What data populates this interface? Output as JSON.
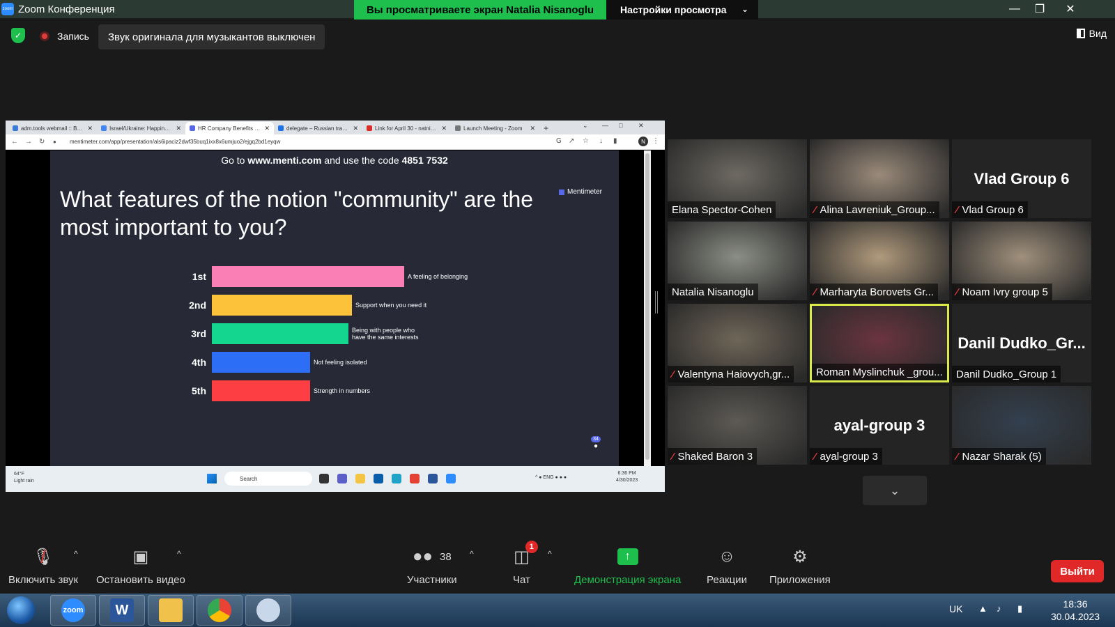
{
  "window": {
    "app_icon": "zoom",
    "title": "Zoom Конференция",
    "share_banner": "Вы просматриваете экран Natalia Nisanoglu",
    "view_settings": "Настройки просмотра",
    "controls": [
      "minimize-icon",
      "restore-icon",
      "close-icon"
    ]
  },
  "status": {
    "recording": "Запись",
    "original_sound": "Звук оригинала для музыкантов выключен",
    "view": "Вид"
  },
  "browser": {
    "tabs": [
      {
        "label": "adm.tools webmail :: Входя",
        "active": false,
        "color": "#3a7bd5"
      },
      {
        "label": "Israel/Ukraine: Happiness a",
        "active": false,
        "color": "#4285f4"
      },
      {
        "label": "HR Company Benefits - Me",
        "active": true,
        "color": "#5769e7"
      },
      {
        "label": "delegate – Russian translati",
        "active": false,
        "color": "#1a73e8"
      },
      {
        "label": "Link for April 30 - natnisan",
        "active": false,
        "color": "#d93025"
      },
      {
        "label": "Launch Meeting - Zoom",
        "active": false,
        "color": "#777777"
      }
    ],
    "url": "mentimeter.com/app/presentation/als6ipaciz2dwf35buq1ixx8x6umjuo2/ejgq2bd1eyqw",
    "profile_initial": "N"
  },
  "menti": {
    "code_prefix": "Go to ",
    "code_site": "www.menti.com",
    "code_mid": " and use the code ",
    "code": "4851 7532",
    "brand": "Mentimeter",
    "question": "What features of the notion \"community\" are the most important to you?",
    "participants": "34"
  },
  "chart_data": {
    "type": "bar",
    "orientation": "horizontal",
    "categories": [
      "1st",
      "2nd",
      "3rd",
      "4th",
      "5th"
    ],
    "labels": [
      "A feeling of belonging",
      "Support when you need it",
      "Being with people who have the same interests",
      "Not feeling isolated",
      "Strength in numbers"
    ],
    "values": [
      1.0,
      0.73,
      0.71,
      0.51,
      0.51
    ],
    "colors": [
      "#f97fb5",
      "#fcc33a",
      "#14d68f",
      "#2d6ef6",
      "#fd3e42"
    ]
  },
  "win11_taskbar": {
    "weather_temp": "64°F",
    "weather_desc": "Light rain",
    "search": "Search",
    "lang": "ENG",
    "time": "6:36 PM",
    "date": "4/30/2023"
  },
  "participants": [
    {
      "name": "Elana Spector-Cohen",
      "muted": false,
      "video": true,
      "bg": "#6e6a63",
      "active": false
    },
    {
      "name": "Alina Lavreniuk_Group...",
      "muted": true,
      "video": true,
      "bg": "#9a8a7a",
      "active": false
    },
    {
      "name": "Vlad Group 6",
      "muted": true,
      "video": false,
      "big": "Vlad Group 6",
      "active": false
    },
    {
      "name": "Natalia Nisanoglu",
      "muted": false,
      "video": true,
      "bg": "#8b8e85",
      "active": false
    },
    {
      "name": "Marharyta Borovets Gr...",
      "muted": true,
      "video": true,
      "bg": "#b09a7c",
      "active": false
    },
    {
      "name": "Noam Ivry group 5",
      "muted": true,
      "video": true,
      "bg": "#a0907c",
      "active": false
    },
    {
      "name": "Valentyna Haiovych,gr...",
      "muted": true,
      "video": true,
      "bg": "#6f6658",
      "active": false
    },
    {
      "name": "Roman Myslinchuk _grou...",
      "muted": false,
      "video": true,
      "bg": "#6b3440",
      "active": true
    },
    {
      "name": "Danil Dudko_Group 1",
      "muted": false,
      "video": false,
      "big": "Danil  Dudko_Gr...",
      "active": false
    },
    {
      "name": "Shaked Baron 3",
      "muted": true,
      "video": true,
      "bg": "#5d5a55",
      "active": false
    },
    {
      "name": "ayal-group 3",
      "muted": true,
      "video": false,
      "big": "ayal-group 3",
      "active": false
    },
    {
      "name": "Nazar Sharak (5)",
      "muted": true,
      "video": true,
      "bg": "#33404f",
      "active": false
    }
  ],
  "toolbar": {
    "unmute": "Включить звук",
    "stop_video": "Остановить видео",
    "participants": "Участники",
    "participants_count": "38",
    "chat": "Чат",
    "chat_badge": "1",
    "share": "Демонстрация экрана",
    "reactions": "Реакции",
    "apps": "Приложения",
    "leave": "Выйти"
  },
  "taskbar": {
    "lang": "UK",
    "time": "18:36",
    "date": "30.04.2023",
    "apps": [
      "zoom",
      "word",
      "explorer",
      "chrome",
      "paint"
    ]
  }
}
